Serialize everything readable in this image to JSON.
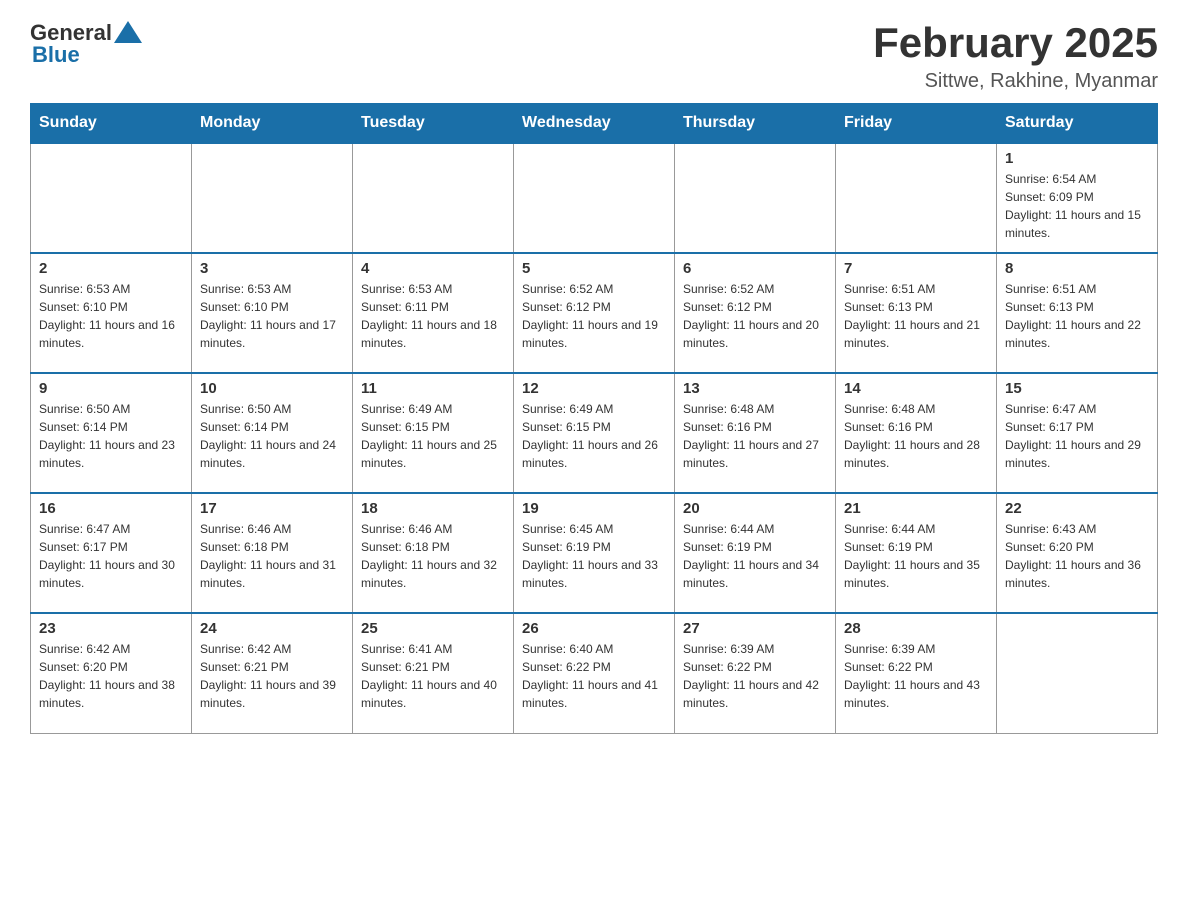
{
  "header": {
    "logo_general": "General",
    "logo_blue": "Blue",
    "month_title": "February 2025",
    "location": "Sittwe, Rakhine, Myanmar"
  },
  "days_of_week": [
    "Sunday",
    "Monday",
    "Tuesday",
    "Wednesday",
    "Thursday",
    "Friday",
    "Saturday"
  ],
  "weeks": [
    [
      {
        "day": "",
        "sunrise": "",
        "sunset": "",
        "daylight": ""
      },
      {
        "day": "",
        "sunrise": "",
        "sunset": "",
        "daylight": ""
      },
      {
        "day": "",
        "sunrise": "",
        "sunset": "",
        "daylight": ""
      },
      {
        "day": "",
        "sunrise": "",
        "sunset": "",
        "daylight": ""
      },
      {
        "day": "",
        "sunrise": "",
        "sunset": "",
        "daylight": ""
      },
      {
        "day": "",
        "sunrise": "",
        "sunset": "",
        "daylight": ""
      },
      {
        "day": "1",
        "sunrise": "Sunrise: 6:54 AM",
        "sunset": "Sunset: 6:09 PM",
        "daylight": "Daylight: 11 hours and 15 minutes."
      }
    ],
    [
      {
        "day": "2",
        "sunrise": "Sunrise: 6:53 AM",
        "sunset": "Sunset: 6:10 PM",
        "daylight": "Daylight: 11 hours and 16 minutes."
      },
      {
        "day": "3",
        "sunrise": "Sunrise: 6:53 AM",
        "sunset": "Sunset: 6:10 PM",
        "daylight": "Daylight: 11 hours and 17 minutes."
      },
      {
        "day": "4",
        "sunrise": "Sunrise: 6:53 AM",
        "sunset": "Sunset: 6:11 PM",
        "daylight": "Daylight: 11 hours and 18 minutes."
      },
      {
        "day": "5",
        "sunrise": "Sunrise: 6:52 AM",
        "sunset": "Sunset: 6:12 PM",
        "daylight": "Daylight: 11 hours and 19 minutes."
      },
      {
        "day": "6",
        "sunrise": "Sunrise: 6:52 AM",
        "sunset": "Sunset: 6:12 PM",
        "daylight": "Daylight: 11 hours and 20 minutes."
      },
      {
        "day": "7",
        "sunrise": "Sunrise: 6:51 AM",
        "sunset": "Sunset: 6:13 PM",
        "daylight": "Daylight: 11 hours and 21 minutes."
      },
      {
        "day": "8",
        "sunrise": "Sunrise: 6:51 AM",
        "sunset": "Sunset: 6:13 PM",
        "daylight": "Daylight: 11 hours and 22 minutes."
      }
    ],
    [
      {
        "day": "9",
        "sunrise": "Sunrise: 6:50 AM",
        "sunset": "Sunset: 6:14 PM",
        "daylight": "Daylight: 11 hours and 23 minutes."
      },
      {
        "day": "10",
        "sunrise": "Sunrise: 6:50 AM",
        "sunset": "Sunset: 6:14 PM",
        "daylight": "Daylight: 11 hours and 24 minutes."
      },
      {
        "day": "11",
        "sunrise": "Sunrise: 6:49 AM",
        "sunset": "Sunset: 6:15 PM",
        "daylight": "Daylight: 11 hours and 25 minutes."
      },
      {
        "day": "12",
        "sunrise": "Sunrise: 6:49 AM",
        "sunset": "Sunset: 6:15 PM",
        "daylight": "Daylight: 11 hours and 26 minutes."
      },
      {
        "day": "13",
        "sunrise": "Sunrise: 6:48 AM",
        "sunset": "Sunset: 6:16 PM",
        "daylight": "Daylight: 11 hours and 27 minutes."
      },
      {
        "day": "14",
        "sunrise": "Sunrise: 6:48 AM",
        "sunset": "Sunset: 6:16 PM",
        "daylight": "Daylight: 11 hours and 28 minutes."
      },
      {
        "day": "15",
        "sunrise": "Sunrise: 6:47 AM",
        "sunset": "Sunset: 6:17 PM",
        "daylight": "Daylight: 11 hours and 29 minutes."
      }
    ],
    [
      {
        "day": "16",
        "sunrise": "Sunrise: 6:47 AM",
        "sunset": "Sunset: 6:17 PM",
        "daylight": "Daylight: 11 hours and 30 minutes."
      },
      {
        "day": "17",
        "sunrise": "Sunrise: 6:46 AM",
        "sunset": "Sunset: 6:18 PM",
        "daylight": "Daylight: 11 hours and 31 minutes."
      },
      {
        "day": "18",
        "sunrise": "Sunrise: 6:46 AM",
        "sunset": "Sunset: 6:18 PM",
        "daylight": "Daylight: 11 hours and 32 minutes."
      },
      {
        "day": "19",
        "sunrise": "Sunrise: 6:45 AM",
        "sunset": "Sunset: 6:19 PM",
        "daylight": "Daylight: 11 hours and 33 minutes."
      },
      {
        "day": "20",
        "sunrise": "Sunrise: 6:44 AM",
        "sunset": "Sunset: 6:19 PM",
        "daylight": "Daylight: 11 hours and 34 minutes."
      },
      {
        "day": "21",
        "sunrise": "Sunrise: 6:44 AM",
        "sunset": "Sunset: 6:19 PM",
        "daylight": "Daylight: 11 hours and 35 minutes."
      },
      {
        "day": "22",
        "sunrise": "Sunrise: 6:43 AM",
        "sunset": "Sunset: 6:20 PM",
        "daylight": "Daylight: 11 hours and 36 minutes."
      }
    ],
    [
      {
        "day": "23",
        "sunrise": "Sunrise: 6:42 AM",
        "sunset": "Sunset: 6:20 PM",
        "daylight": "Daylight: 11 hours and 38 minutes."
      },
      {
        "day": "24",
        "sunrise": "Sunrise: 6:42 AM",
        "sunset": "Sunset: 6:21 PM",
        "daylight": "Daylight: 11 hours and 39 minutes."
      },
      {
        "day": "25",
        "sunrise": "Sunrise: 6:41 AM",
        "sunset": "Sunset: 6:21 PM",
        "daylight": "Daylight: 11 hours and 40 minutes."
      },
      {
        "day": "26",
        "sunrise": "Sunrise: 6:40 AM",
        "sunset": "Sunset: 6:22 PM",
        "daylight": "Daylight: 11 hours and 41 minutes."
      },
      {
        "day": "27",
        "sunrise": "Sunrise: 6:39 AM",
        "sunset": "Sunset: 6:22 PM",
        "daylight": "Daylight: 11 hours and 42 minutes."
      },
      {
        "day": "28",
        "sunrise": "Sunrise: 6:39 AM",
        "sunset": "Sunset: 6:22 PM",
        "daylight": "Daylight: 11 hours and 43 minutes."
      },
      {
        "day": "",
        "sunrise": "",
        "sunset": "",
        "daylight": ""
      }
    ]
  ]
}
